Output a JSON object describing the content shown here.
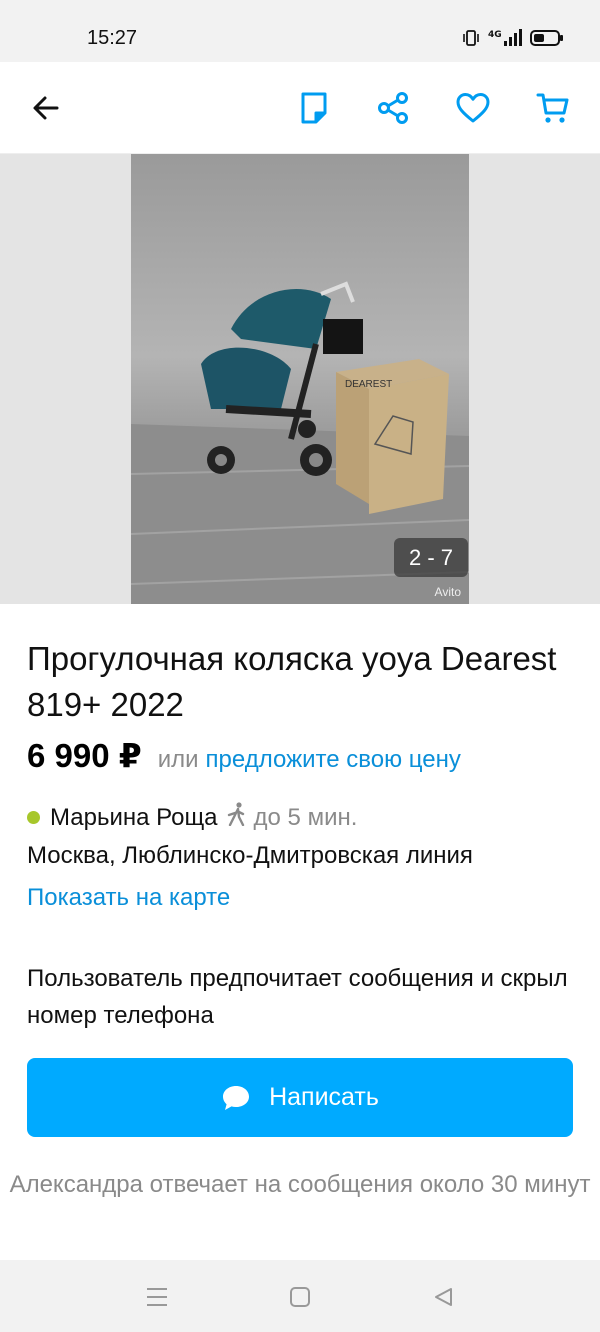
{
  "status_bar": {
    "time": "15:27",
    "icons": [
      "vibrate-icon",
      "signal-4g-icon",
      "battery-icon"
    ],
    "network_label": "4G"
  },
  "toolbar": {
    "icons": [
      "back-arrow-icon",
      "note-icon",
      "share-icon",
      "favorite-heart-icon",
      "cart-icon"
    ],
    "accent_color": "#009cf0"
  },
  "gallery": {
    "counter": "2 - 7",
    "watermark": "Avito",
    "box_label": "DEAREST"
  },
  "listing": {
    "title": "Прогулочная коляска yoya Dearest 819+ 2022",
    "price": "6 990 ₽",
    "or_text": "или",
    "offer_link": "предложите свою цену",
    "metro_station": "Марьина Роща",
    "metro_color": "#a7c72b",
    "walk_time": "до 5 мин.",
    "address": "Москва, Люблинско-Дмитровская линия",
    "map_link": "Показать на карте"
  },
  "contact": {
    "note": "Пользователь предпочитает сообщения и скрыл номер телефона",
    "write_button": "Написать",
    "button_color": "#00aaff",
    "reply_note": "Александра отвечает на сообщения около 30 минут"
  },
  "system_nav": {
    "icons": [
      "menu-icon",
      "home-icon",
      "back-triangle-icon"
    ]
  }
}
